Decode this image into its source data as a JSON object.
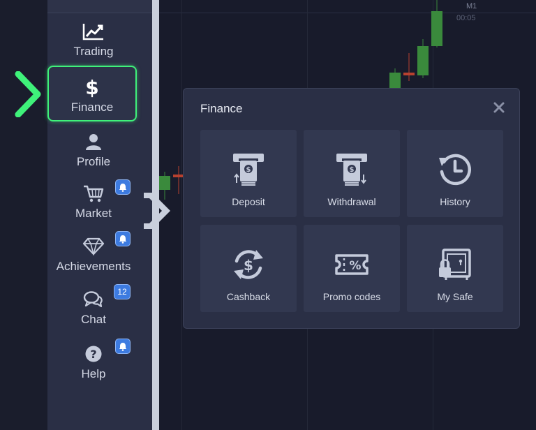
{
  "chart": {
    "timeframe": "M1",
    "time_label": "00:05"
  },
  "sidebar": {
    "items": [
      {
        "label": "Trading",
        "icon": "chart-line-icon"
      },
      {
        "label": "Finance",
        "icon": "dollar-icon",
        "active": true
      },
      {
        "label": "Profile",
        "icon": "user-icon"
      },
      {
        "label": "Market",
        "icon": "cart-icon",
        "badge": "bell"
      },
      {
        "label": "Achievements",
        "icon": "diamond-icon",
        "badge": "bell"
      },
      {
        "label": "Chat",
        "icon": "chat-icon",
        "badge": "12"
      },
      {
        "label": "Help",
        "icon": "help-icon",
        "badge": "bell"
      }
    ]
  },
  "finance_panel": {
    "title": "Finance",
    "tiles": [
      {
        "label": "Deposit",
        "icon": "deposit-icon"
      },
      {
        "label": "Withdrawal",
        "icon": "withdrawal-icon"
      },
      {
        "label": "History",
        "icon": "history-icon"
      },
      {
        "label": "Cashback",
        "icon": "cashback-icon"
      },
      {
        "label": "Promo codes",
        "icon": "promo-code-icon"
      },
      {
        "label": "My Safe",
        "icon": "safe-icon"
      }
    ]
  },
  "colors": {
    "accent_green": "#3ff27a",
    "badge_blue": "#3d7be0",
    "panel_bg": "#2a2f45",
    "tile_bg": "#323850",
    "icon_color": "#c5cbdb"
  }
}
